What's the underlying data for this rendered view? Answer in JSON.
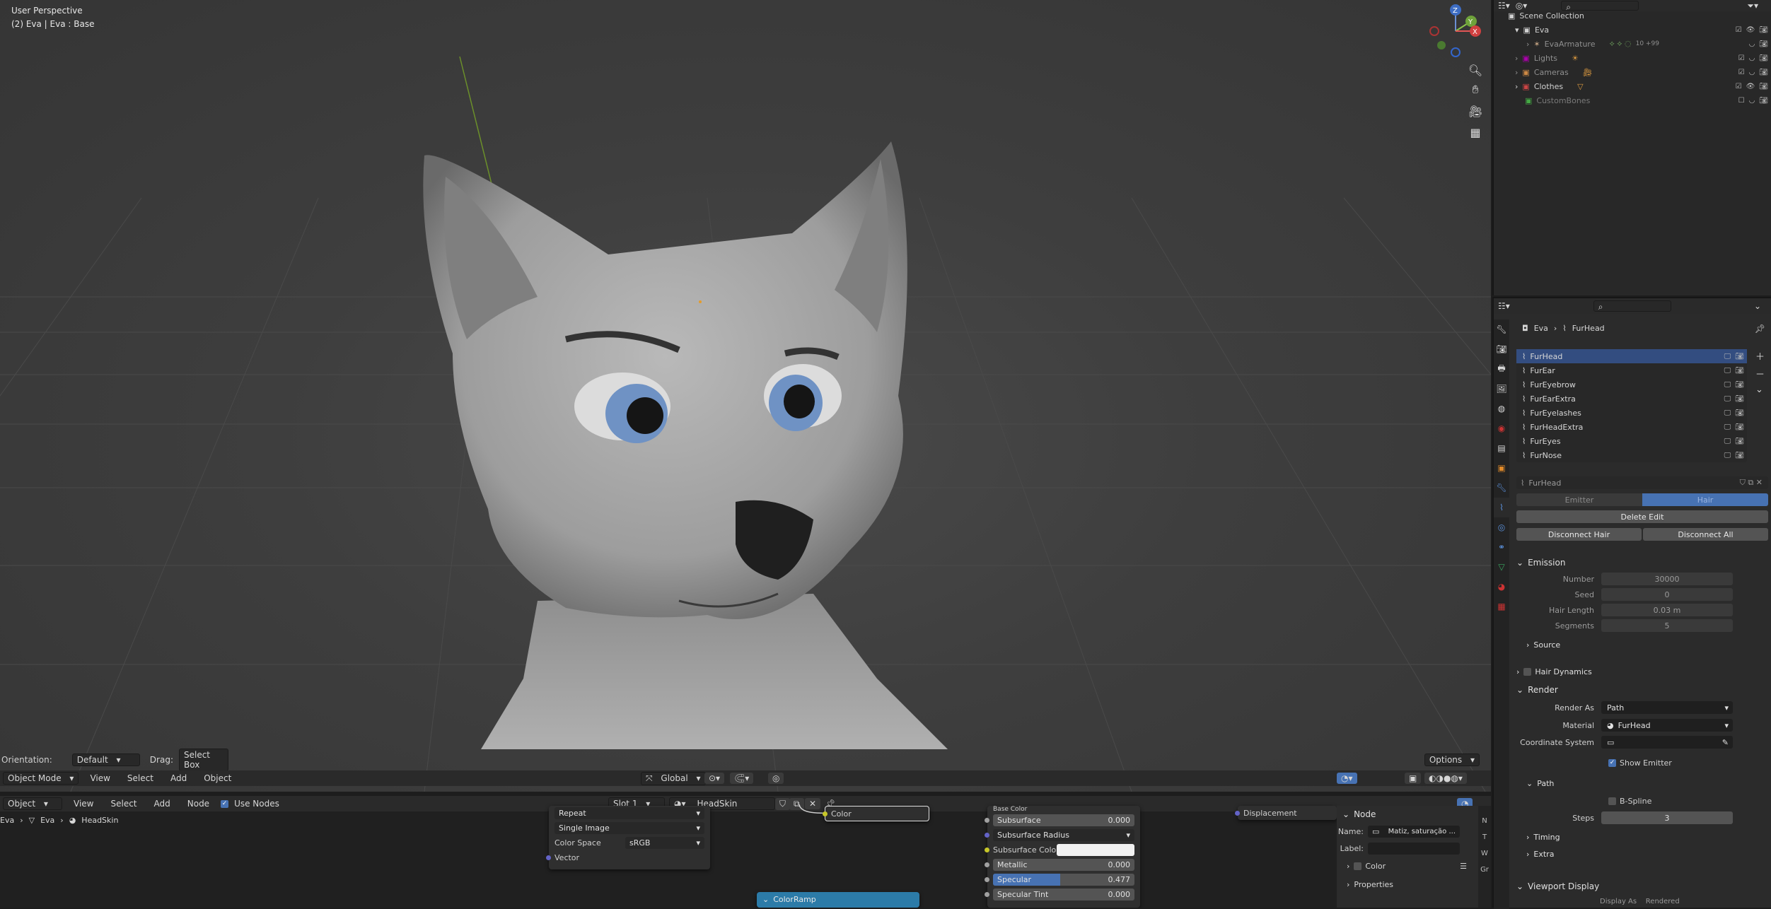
{
  "viewport": {
    "perspective": "User Perspective",
    "object_info": "(2) Eva | Eva : Base",
    "gizmo_axes": [
      "Z",
      "Y",
      "X"
    ]
  },
  "viewport_footer": {
    "orientation_label": "Orientation:",
    "orientation_value": "Default",
    "drag_label": "Drag:",
    "drag_value": "Select Box",
    "options": "Options"
  },
  "viewport_header": {
    "mode": "Object Mode",
    "menus": [
      "View",
      "Select",
      "Add",
      "Object"
    ],
    "transform_orientation": "Global"
  },
  "node_header": {
    "editor_type": "Object",
    "menus": [
      "View",
      "Select",
      "Add",
      "Node"
    ],
    "use_nodes_label": "Use Nodes",
    "slot": "Slot 1",
    "material": "HeadSkin"
  },
  "node_breadcrumb": [
    "Eva",
    "Eva",
    "HeadSkin"
  ],
  "nodes": {
    "image_texture": {
      "extension": "Repeat",
      "projection": "Single Image",
      "color_space_label": "Color Space",
      "color_space": "sRGB",
      "vector": "Vector"
    },
    "color_output": "Color",
    "principled": {
      "base_color": "Base Color",
      "subsurface_label": "Subsurface",
      "subsurface": "0.000",
      "subsurface_radius": "Subsurface Radius",
      "subsurface_color": "Subsurface Colo",
      "metallic_label": "Metallic",
      "metallic": "0.000",
      "specular_label": "Specular",
      "specular": "0.477",
      "specular_fill": 0.477,
      "specular_tint_label": "Specular Tint",
      "specular_tint": "0.000"
    },
    "displacement": "Displacement",
    "colorramp": "ColorRamp"
  },
  "node_sidebar": {
    "panel": "Node",
    "name_label": "Name:",
    "name_value": "Matiz, saturação ...",
    "label_label": "Label:",
    "color_label": "Color",
    "properties_label": "Properties",
    "tabs": [
      "N",
      "T",
      "W",
      "Gr"
    ]
  },
  "outliner": {
    "collection": "Scene Collection",
    "items": [
      {
        "name": "Eva",
        "level": 1,
        "expanded": true
      },
      {
        "name": "EvaArmature",
        "level": 2,
        "extra": "10 +99"
      },
      {
        "name": "Lights",
        "level": 1
      },
      {
        "name": "Cameras",
        "level": 1
      },
      {
        "name": "Clothes",
        "level": 1
      },
      {
        "name": "CustomBones",
        "level": 1
      }
    ]
  },
  "properties": {
    "breadcrumb": [
      "Eva",
      "FurHead"
    ],
    "particle_systems": [
      "FurHead",
      "FurEar",
      "FurEyebrow",
      "FurEarExtra",
      "FurEyelashes",
      "FurHeadExtra",
      "FurEyes",
      "FurNose"
    ],
    "active_system": "FurHead",
    "type_tabs": [
      "Emitter",
      "Hair"
    ],
    "active_type": "Hair",
    "delete_edit": "Delete Edit",
    "disconnect_hair": "Disconnect Hair",
    "disconnect_all": "Disconnect All",
    "emission": {
      "title": "Emission",
      "fields": [
        {
          "label": "Number",
          "value": "30000"
        },
        {
          "label": "Seed",
          "value": "0"
        },
        {
          "label": "Hair Length",
          "value": "0.03 m"
        },
        {
          "label": "Segments",
          "value": "5"
        }
      ]
    },
    "source": "Source",
    "hair_dynamics": "Hair Dynamics",
    "render": {
      "title": "Render",
      "render_as_label": "Render As",
      "render_as": "Path",
      "material_label": "Material",
      "material": "FurHead",
      "coord_label": "Coordinate System",
      "show_emitter": "Show Emitter"
    },
    "path": {
      "title": "Path",
      "bspline": "B-Spline",
      "steps_label": "Steps",
      "steps": "3"
    },
    "timing": "Timing",
    "extra": "Extra",
    "viewport_display": "Viewport Display",
    "display_as_partial": "Display As    Rendered"
  },
  "colors": {
    "accent": "#4772b3",
    "selected_row": "#334d80",
    "node_header_blue": "#2c7ba8"
  }
}
